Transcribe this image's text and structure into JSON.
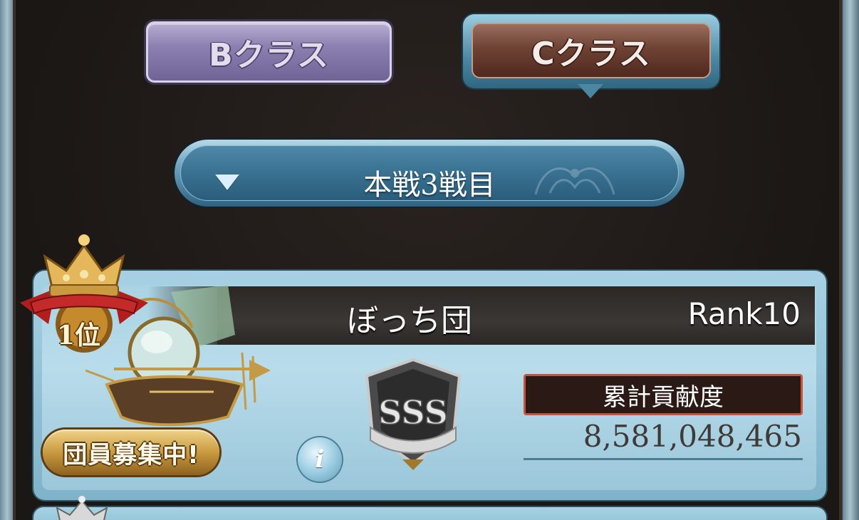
{
  "class_tabs": [
    {
      "label": "Bクラス",
      "selected": false
    },
    {
      "label": "Cクラス",
      "selected": true
    }
  ],
  "round_select": {
    "value": "本戦3戦目"
  },
  "crew": {
    "ranking": "1位",
    "name": "ぼっち団",
    "rank": "Rank10",
    "recruit_label": "団員募集中!",
    "grade": "SSS",
    "contribution_label": "累計貢献度",
    "contribution_value": "8,581,048,465"
  },
  "colors": {
    "tab_b": "#8c80b1",
    "tab_c": "#6e4334",
    "frame_blue": "#7fb3ca",
    "header_dark": "#2a2725",
    "contrib_border": "#c9523a",
    "recruit_gold": "#c99a3f"
  },
  "icons": {
    "dropdown": "caret-down-icon",
    "info": "info-icon",
    "crown": "crown-icon",
    "grade": "sss-emblem-icon",
    "airship": "airship-icon"
  }
}
